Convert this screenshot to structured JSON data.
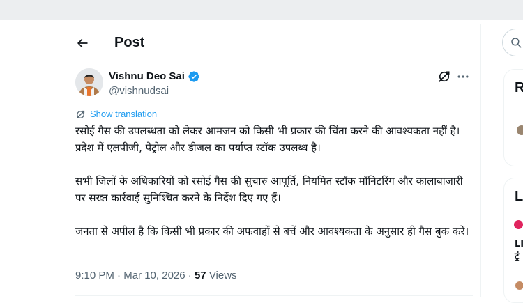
{
  "header": {
    "title": "Post"
  },
  "post": {
    "author_name": "Vishnu Deo Sai",
    "author_handle": "@vishnudsai",
    "show_translation": "Show translation",
    "paragraphs": [
      "रसोई गैस की उपलब्धता को लेकर आमजन को किसी भी प्रकार की चिंता करने की आवश्यकता नहीं है। प्रदेश में एलपीजी, पेट्रोल और डीजल का पर्याप्त स्टॉक उपलब्ध है।",
      "सभी जिलों के अधिकारियों को रसोई गैस की सुचारु आपूर्ति, नियमित स्टॉक मॉनिटरिंग और कालाबाजारी पर सख्त कार्रवाई सुनिश्चित करने के निर्देश दिए गए हैं।",
      "जनता से अपील है कि किसी भी प्रकार की अफवाहों से बचें और आवश्यकता के अनुसार ही गैस बुक करें।"
    ],
    "time": "9:10 PM",
    "separator": " · ",
    "date": "Mar 10, 2026",
    "views_count": "57",
    "views_label": "Views"
  },
  "sidebar": {
    "card_a_heading": "R",
    "card_b_heading": "Li",
    "news_line_1": "LI",
    "news_line_2": "ट्रं"
  },
  "colors": {
    "accent": "#1d9bf0",
    "secondary_text": "#536471",
    "primary_text": "#0f1419"
  },
  "icons": {
    "back": "arrow-left-icon",
    "verified": "verified-badge-icon",
    "grok": "grok-icon",
    "more": "more-horizontal-icon",
    "translate": "translate-icon",
    "search": "search-icon"
  }
}
